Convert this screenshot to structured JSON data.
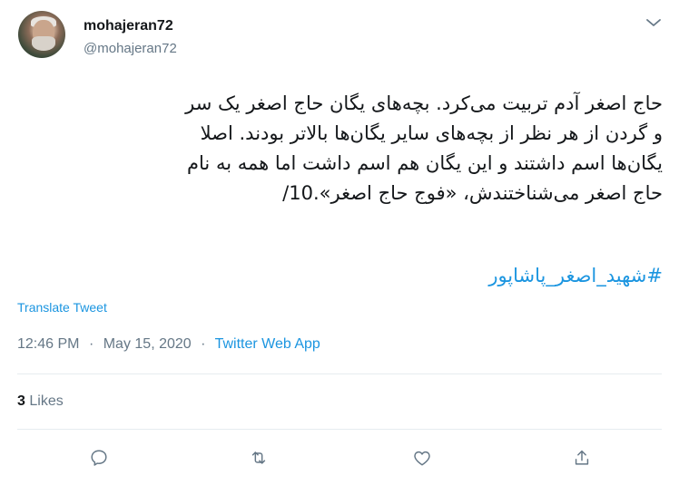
{
  "user": {
    "display_name": "mohajeran72",
    "handle": "@mohajeran72"
  },
  "tweet": {
    "text": "حاج اصغر آدم تربیت می‌کرد. بچه‌های یگان حاج اصغر یک سر\nو گردن از هر نظر از بچه‌های سایر یگان‌ها بالاتر بودند. اصلا\nیگان‌ها اسم داشتند و این یگان هم اسم داشت اما همه به نام\nحاج اصغر می‌شناختندش، «فوج حاج اصغر».10/",
    "hashtag": "#شهید_اصغر_پاشاپور",
    "translate_label": "Translate Tweet",
    "time": "12:46 PM",
    "date": "May 15, 2020",
    "separator": "·",
    "source": "Twitter Web App",
    "likes_count": "3",
    "likes_label": "Likes"
  },
  "icons": {
    "caret": "chevron-down-icon",
    "reply": "reply-icon",
    "retweet": "retweet-icon",
    "like": "heart-icon",
    "share": "share-icon"
  },
  "colors": {
    "link": "#1b95e0",
    "secondary": "#657786",
    "text": "#14171a",
    "divider": "#e6ecf0"
  }
}
